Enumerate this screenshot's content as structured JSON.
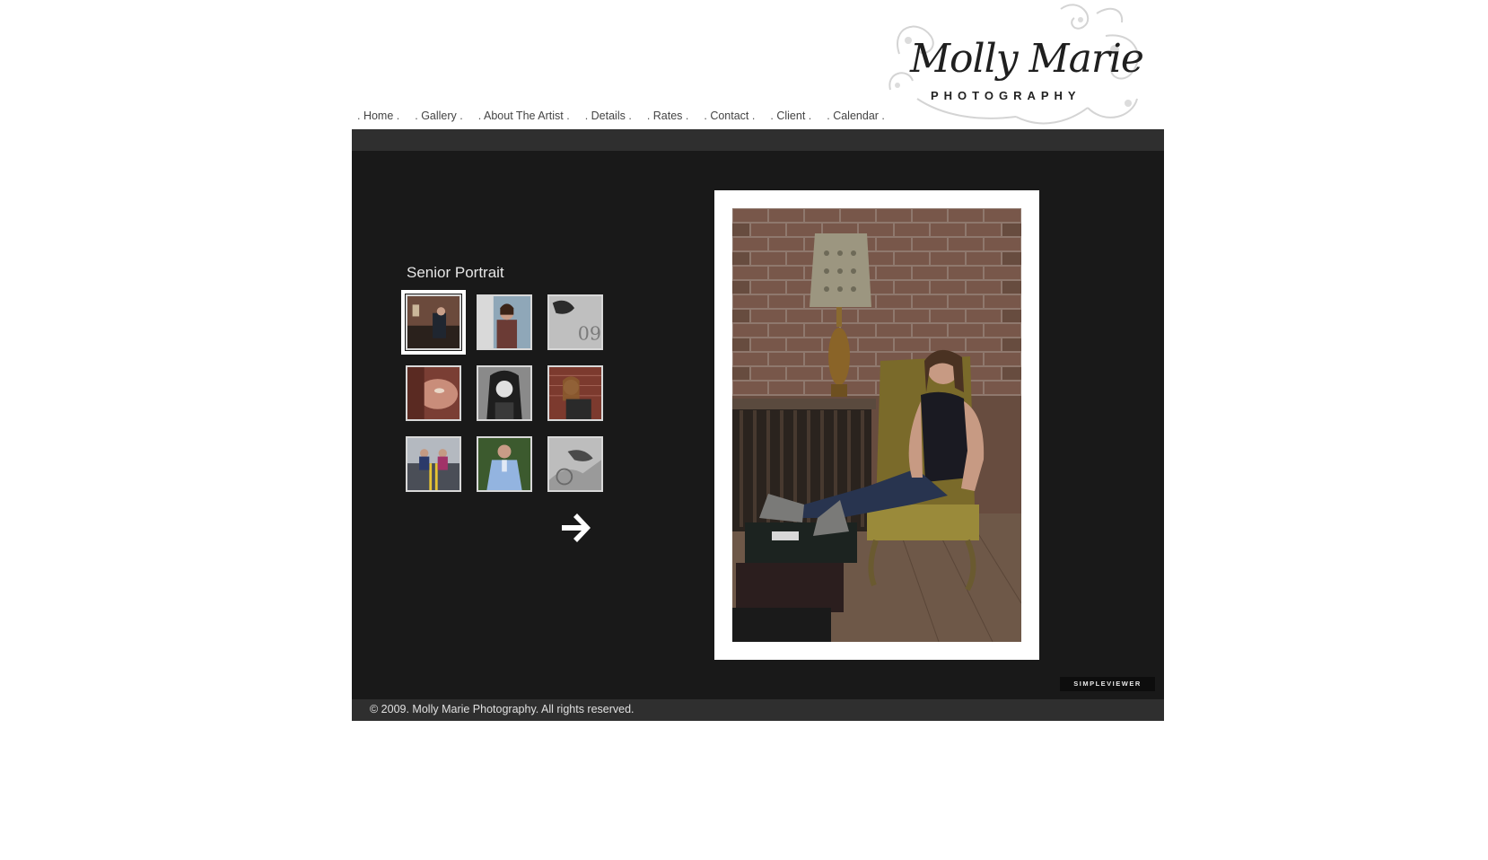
{
  "header": {
    "logo": {
      "script": "Molly Marie",
      "subtitle": "PHOTOGRAPHY"
    },
    "nav": [
      {
        "label": "Home"
      },
      {
        "label": "Gallery"
      },
      {
        "label": "About The Artist"
      },
      {
        "label": "Details"
      },
      {
        "label": "Rates"
      },
      {
        "label": "Contact"
      },
      {
        "label": "Client"
      },
      {
        "label": "Calendar"
      }
    ]
  },
  "gallery": {
    "title": "Senior Portrait",
    "selected_index": 0,
    "thumbnails": [
      {
        "icon": "portrait-thumbnail",
        "tone": "color"
      },
      {
        "icon": "portrait-thumbnail",
        "tone": "color"
      },
      {
        "icon": "portrait-thumbnail",
        "tone": "bw"
      },
      {
        "icon": "portrait-thumbnail",
        "tone": "color"
      },
      {
        "icon": "portrait-thumbnail",
        "tone": "bw"
      },
      {
        "icon": "portrait-thumbnail",
        "tone": "color"
      },
      {
        "icon": "portrait-thumbnail",
        "tone": "color"
      },
      {
        "icon": "portrait-thumbnail",
        "tone": "color"
      },
      {
        "icon": "portrait-thumbnail",
        "tone": "bw"
      }
    ],
    "next_icon": "arrow-right-icon",
    "viewer_badge": "SIMPLEVIEWER"
  },
  "footer": {
    "copyright": "© 2009. Molly Marie Photography. All rights reserved."
  },
  "colors": {
    "panel": "#191919",
    "bar": "#2f2f2f",
    "text_light": "#e6e6e6"
  }
}
